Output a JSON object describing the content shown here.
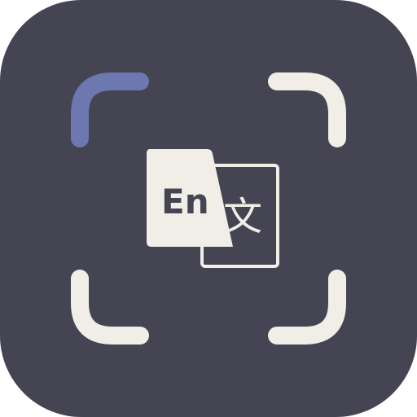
{
  "icon": {
    "name": "translate-scan-app-icon",
    "background_color": "#444453",
    "accent_color": "#6D78B0",
    "foreground_color": "#F0EEE6",
    "source_text": "En",
    "target_text": "文"
  }
}
